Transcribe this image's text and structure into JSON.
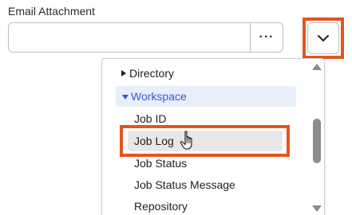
{
  "field": {
    "label": "Email Attachment",
    "value": "",
    "ellipsis_label": "···"
  },
  "dropdown": {
    "items": [
      {
        "label": "Directory",
        "type": "folder",
        "expanded": false
      },
      {
        "label": "Workspace",
        "type": "folder",
        "expanded": true
      },
      {
        "label": "Job ID",
        "type": "leaf"
      },
      {
        "label": "Job Log",
        "type": "leaf",
        "hovered": true
      },
      {
        "label": "Job Status",
        "type": "leaf"
      },
      {
        "label": "Job Status Message",
        "type": "leaf"
      },
      {
        "label": "Repository",
        "type": "leaf"
      }
    ]
  },
  "colors": {
    "highlight": "#e4551c",
    "accent": "#2d5bd8",
    "selected_bg": "#e9eefb",
    "hover_bg": "#e7e7e7"
  },
  "icons": {
    "dropdown_toggle": "chevron-down-icon",
    "collapsed": "triangle-right-icon",
    "expanded": "triangle-down-icon",
    "cursor": "hand-pointer-icon"
  }
}
